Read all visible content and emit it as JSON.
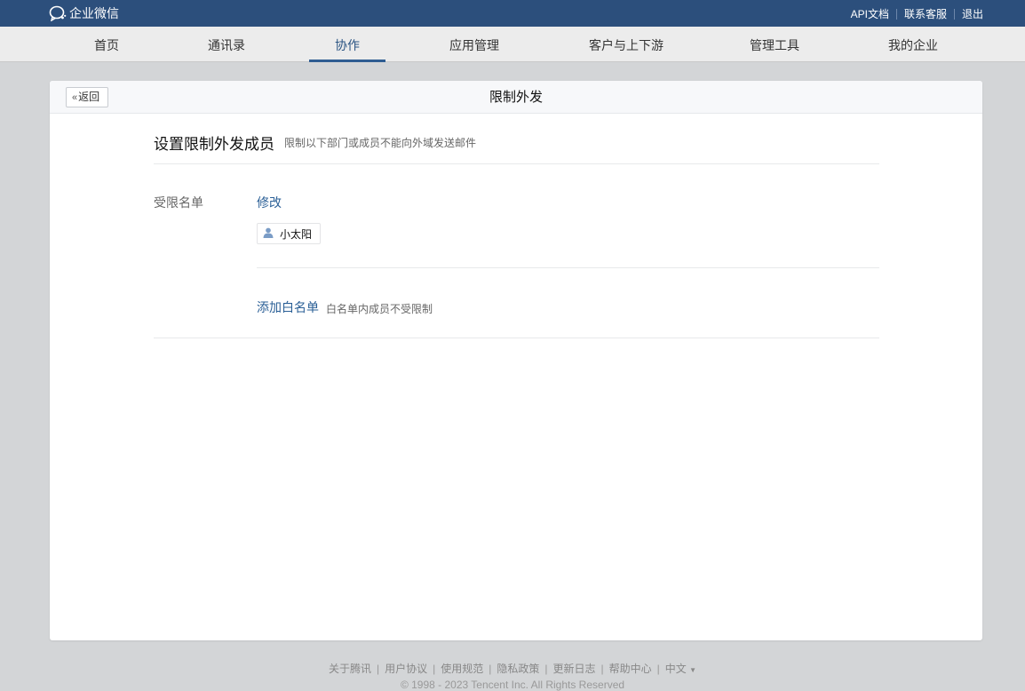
{
  "brand": {
    "name": "企业微信"
  },
  "top_links": [
    "API文档",
    "联系客服",
    "退出"
  ],
  "nav": {
    "items": [
      "首页",
      "通讯录",
      "协作",
      "应用管理",
      "客户与上下游",
      "管理工具",
      "我的企业"
    ],
    "active": "协作"
  },
  "panel": {
    "back_label": "返回",
    "title": "限制外发",
    "section_title": "设置限制外发成员",
    "section_subtitle": "限制以下部门或成员不能向外域发送邮件",
    "restricted_label": "受限名单",
    "edit_link": "修改",
    "member_name": "小太阳",
    "whitelist_link": "添加白名单",
    "whitelist_hint": "白名单内成员不受限制"
  },
  "footer": {
    "links": [
      "关于腾讯",
      "用户协议",
      "使用规范",
      "隐私政策",
      "更新日志",
      "帮助中心"
    ],
    "language": "中文",
    "copyright": "© 1998 - 2023 Tencent Inc. All Rights Reserved"
  },
  "colors": {
    "topbar": "#2c4f7c",
    "link": "#2a5f96",
    "background": "#d3d5d7"
  },
  "icons": {
    "logo": "wecom-logo-icon",
    "back": "double-chevron-left-icon",
    "member": "user-icon",
    "language_dropdown": "caret-down-icon"
  }
}
